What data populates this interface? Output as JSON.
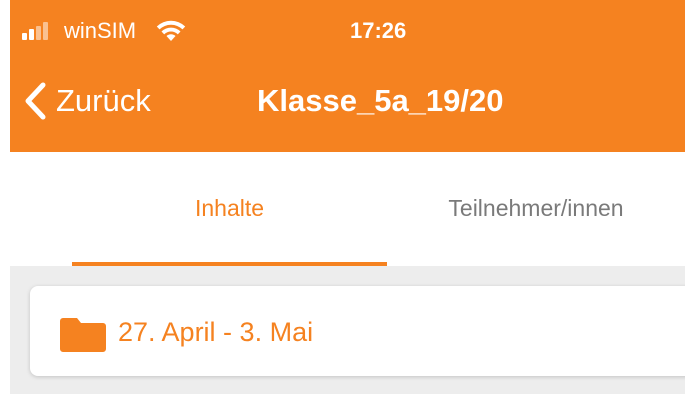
{
  "colors": {
    "accent": "#f58220",
    "white": "#ffffff",
    "tab_inactive": "#7a7a7a",
    "content_bg": "#ededed"
  },
  "status_bar": {
    "carrier": "winSIM",
    "time": "17:26",
    "signal_bars_active": 2,
    "signal_bars_total": 4
  },
  "nav": {
    "back_label": "Zurück",
    "title": "Klasse_5a_19/20"
  },
  "tabs": [
    {
      "label": "Inhalte",
      "selected": true
    },
    {
      "label": "Teilnehmer/innen",
      "selected": false
    }
  ],
  "items": [
    {
      "icon": "folder-icon",
      "label": "27. April - 3. Mai"
    }
  ]
}
